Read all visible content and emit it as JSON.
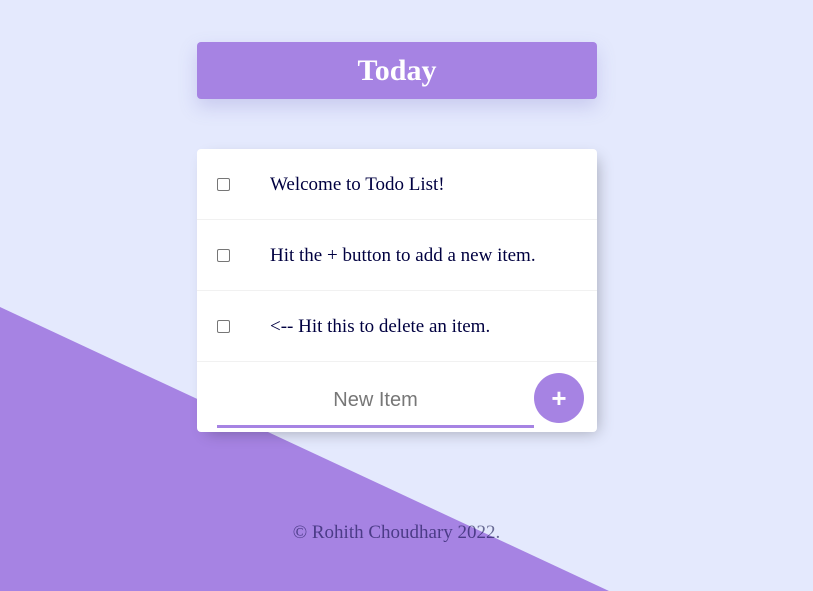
{
  "heading": {
    "title": "Today"
  },
  "todo": {
    "items": [
      {
        "label": "Welcome to Todo List!",
        "checked": false
      },
      {
        "label": "Hit the + button to add a new item.",
        "checked": false
      },
      {
        "label": "<-- Hit this to delete an item.",
        "checked": false
      }
    ],
    "new_item_placeholder": "New Item",
    "add_button_label": "+"
  },
  "footer": {
    "text": "© Rohith Choudhary 2022."
  },
  "colors": {
    "background": "#E4E9FD",
    "accent": "#A683E3",
    "card": "#FFFFFF"
  }
}
